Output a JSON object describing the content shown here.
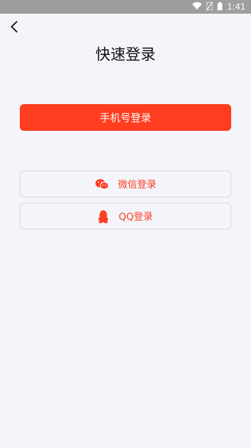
{
  "status_bar": {
    "time": "1:41",
    "icons": [
      "wifi-icon",
      "no-sim-icon",
      "battery-icon"
    ]
  },
  "header": {
    "back_icon": "chevron-left-icon",
    "title": "快速登录"
  },
  "buttons": {
    "phone_login": "手机号登录",
    "wechat_login": "微信登录",
    "qq_login": "QQ登录"
  },
  "colors": {
    "accent": "#ff3d1f",
    "background": "#f4f4fb",
    "status_bar": "#9e9e9e"
  }
}
